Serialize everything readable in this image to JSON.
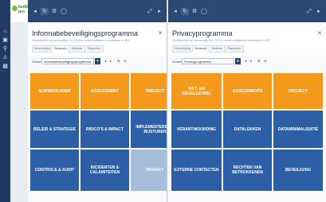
{
  "app": {
    "brand": "kudit\npro",
    "accent": "#1f3b62"
  },
  "icons": {
    "nav": [
      "home-icon",
      "dashboard-icon",
      "search-icon",
      "alert-icon",
      "grid-icon"
    ],
    "top": [
      "collapse-icon",
      "refresh-icon",
      "settings-icon",
      "comment-icon",
      "expand-icon",
      "pin-icon"
    ]
  },
  "left": {
    "title": "Informatiebeveiligingsprogramma",
    "subtitle": "Gepubliceerd op vierkantjtag, live 2015 te versie kwalitatieve framework en BIO",
    "tabs": [
      "Omschrijving",
      "Schema's",
      "Matrices",
      "Rapporten"
    ],
    "scheme_label": "Schema",
    "scheme_value": "Informatiebeveiligingsprogramma",
    "tiles": [
      {
        "label": "NORMENKADER",
        "color": "orange"
      },
      {
        "label": "ASSESSMENT",
        "color": "orange"
      },
      {
        "label": "PROJECT",
        "color": "orange"
      },
      {
        "label": "BELEID & STRATEGIE",
        "color": "blue"
      },
      {
        "label": "RISICO'S & IMPACT",
        "color": "blue"
      },
      {
        "label": "IMPLEMENTEREN & BIJSTUREN",
        "color": "blue"
      },
      {
        "label": "CONTROLE & AUDIT",
        "color": "blue"
      },
      {
        "label": "INCIDENTEN & CALAMITEITEN",
        "color": "blue"
      },
      {
        "label": "PRIVACY",
        "color": "light"
      }
    ]
  },
  "right": {
    "title": "Privacyprogramma",
    "subtitle": "Gepubliceerd op vierkantjtag, live 2015 te versie kwalitatieve framework en BIO",
    "tabs": [
      "Omschrijving",
      "Schema's",
      "Matrices",
      "Rapporten"
    ],
    "scheme_label": "Schema",
    "scheme_value": "Privacyprogramma",
    "tiles": [
      {
        "label": "WET- EN REGELGEVING",
        "color": "orange"
      },
      {
        "label": "ASSESSMENTS",
        "color": "orange"
      },
      {
        "label": "PROJECT",
        "color": "orange"
      },
      {
        "label": "VERANTWOORDING",
        "color": "blue"
      },
      {
        "label": "DATALEKKEN",
        "color": "blue"
      },
      {
        "label": "DATAMINIMALISATIE",
        "color": "blue"
      },
      {
        "label": "EXTERNE CONTACTEN",
        "color": "blue"
      },
      {
        "label": "RECHTEN VAN BETROKKENEN",
        "color": "blue"
      },
      {
        "label": "BEVEILIGING",
        "color": "blue"
      }
    ]
  }
}
